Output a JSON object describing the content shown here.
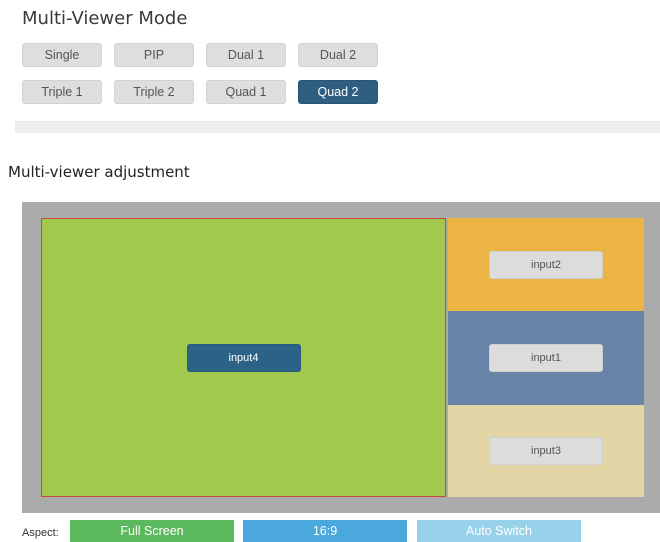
{
  "mode_section": {
    "title": "Multi-Viewer Mode",
    "buttons": [
      {
        "label": "Single"
      },
      {
        "label": "PIP"
      },
      {
        "label": "Dual 1"
      },
      {
        "label": "Dual 2"
      },
      {
        "label": "Triple 1"
      },
      {
        "label": "Triple 2"
      },
      {
        "label": "Quad 1"
      },
      {
        "label": "Quad 2",
        "selected": true
      }
    ]
  },
  "adjustment": {
    "title": "Multi-viewer adjustment",
    "windows": [
      {
        "input": "input4",
        "color": "#a3c84f",
        "button_color": "#2c6285"
      },
      {
        "input": "input2",
        "color": "#ebb444",
        "button_color": "#dcdcdc"
      },
      {
        "input": "input1",
        "color": "#6783a5",
        "button_color": "#dcdcdc"
      },
      {
        "input": "input3",
        "color": "#e2d6a6",
        "button_color": "#dcdcdc"
      }
    ],
    "selection_border_color": "#c8463a",
    "canvas_color": "#ababab"
  },
  "aspect": {
    "label": "Aspect:",
    "options": [
      {
        "label": "Full Screen",
        "color": "#5cb85c"
      },
      {
        "label": "16:9",
        "color": "#4aa8dd"
      },
      {
        "label": "Auto Switch",
        "color": "#98d2ea"
      }
    ]
  },
  "colors": {
    "selected_mode": "#2e5f80",
    "mode_button": "#dedede"
  }
}
